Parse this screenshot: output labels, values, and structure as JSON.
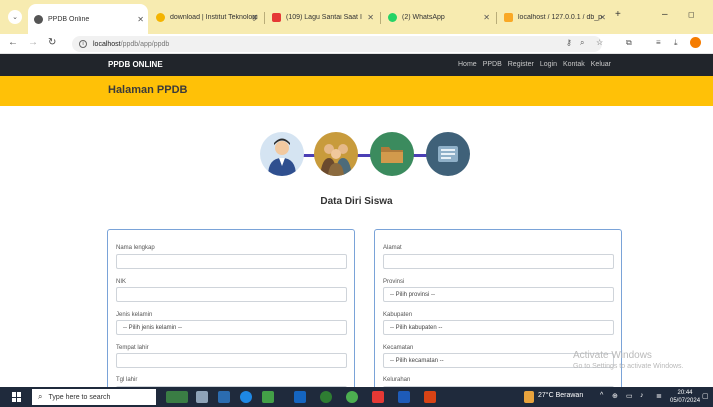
{
  "browser": {
    "tabs": [
      {
        "title": "PPDB Online",
        "active": true,
        "favicon_color": "#555555"
      },
      {
        "title": "download | Institut Teknologi",
        "active": false,
        "favicon_color": "#f4b400"
      },
      {
        "title": "(109) Lagu Santai Saat I",
        "active": false,
        "favicon_color": "#e53935"
      },
      {
        "title": "(2) WhatsApp",
        "active": false,
        "favicon_color": "#25d366"
      },
      {
        "title": "localhost / 127.0.0.1 / db_p",
        "active": false,
        "favicon_color": "#f9a825"
      }
    ],
    "url_host": "localhost",
    "url_path": "/ppdb/app/ppdb"
  },
  "site": {
    "brand": "PPDB ONLINE",
    "nav": [
      "Home",
      "PPDB",
      "Register",
      "Login",
      "Kontak",
      "Keluar"
    ],
    "page_title": "Halaman PPDB"
  },
  "form": {
    "section_title": "Data Diri Siswa",
    "left": {
      "nama_label": "Nama lengkap",
      "nik_label": "NIK",
      "jk_label": "Jenis kelamin",
      "jk_value": "-- Pilih jenis kelamin --",
      "tempat_label": "Tempat lahir",
      "tgl_label": "Tgl lahir"
    },
    "right": {
      "alamat_label": "Alamat",
      "provinsi_label": "Provinsi",
      "provinsi_value": "-- Pilih provinsi --",
      "kabupaten_label": "Kabupaten",
      "kabupaten_value": "-- Pilih kabupaten --",
      "kecamatan_label": "Kecamatan",
      "kecamatan_value": "-- Pilih kecamatan --",
      "kelurahan_label": "Kelurahan"
    }
  },
  "watermark": {
    "line1": "Activate Windows",
    "line2": "Go to Settings to activate Windows."
  },
  "taskbar": {
    "search_placeholder": "Type here to search",
    "weather": "27°C Berawan",
    "time": "20:44",
    "date": "05/07/2024"
  },
  "colors": {
    "navbar": "#21252b",
    "hero": "#ffc107",
    "tabstrip": "#f7ebb0",
    "card_border": "#7aa3d8",
    "step_line": "#4b3fb5"
  }
}
